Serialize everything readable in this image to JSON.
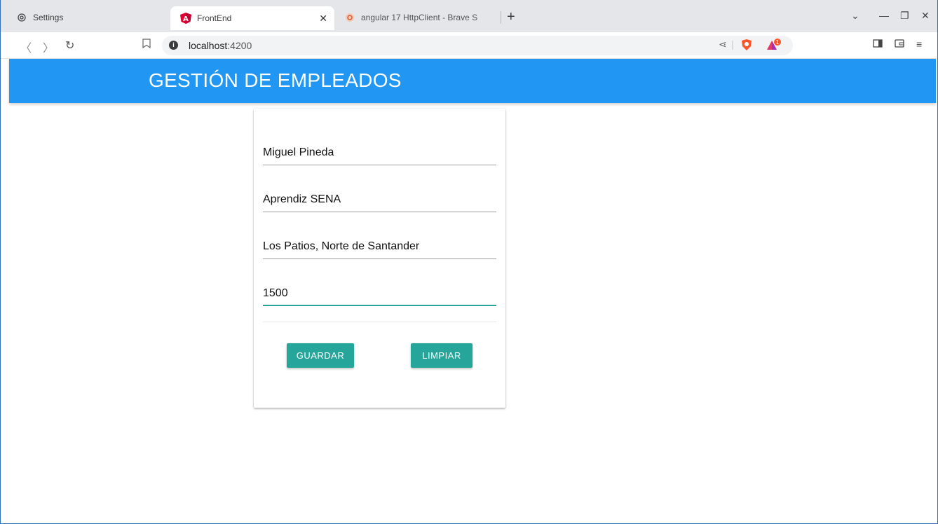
{
  "browser": {
    "tabs": [
      {
        "label": "Settings",
        "icon": "gear-icon"
      },
      {
        "label": "FrontEnd",
        "icon": "angular-logo-icon",
        "active": true
      },
      {
        "label": "angular 17 HttpClient - Brave S",
        "icon": "brave-search-icon"
      }
    ],
    "url_host": "localhost",
    "url_port": ":4200"
  },
  "app": {
    "title": "GESTIÓN DE EMPLEADOS",
    "header_color": "#2196f3",
    "accent_color": "#26a69a"
  },
  "form": {
    "fields": [
      {
        "name": "nombre",
        "value": "Miguel Pineda"
      },
      {
        "name": "cargo",
        "value": "Aprendiz SENA"
      },
      {
        "name": "direccion",
        "value": "Los Patios, Norte de Santander"
      },
      {
        "name": "salario",
        "value": "1500"
      }
    ],
    "save_label": "GUARDAR",
    "clear_label": "LIMPIAR"
  }
}
